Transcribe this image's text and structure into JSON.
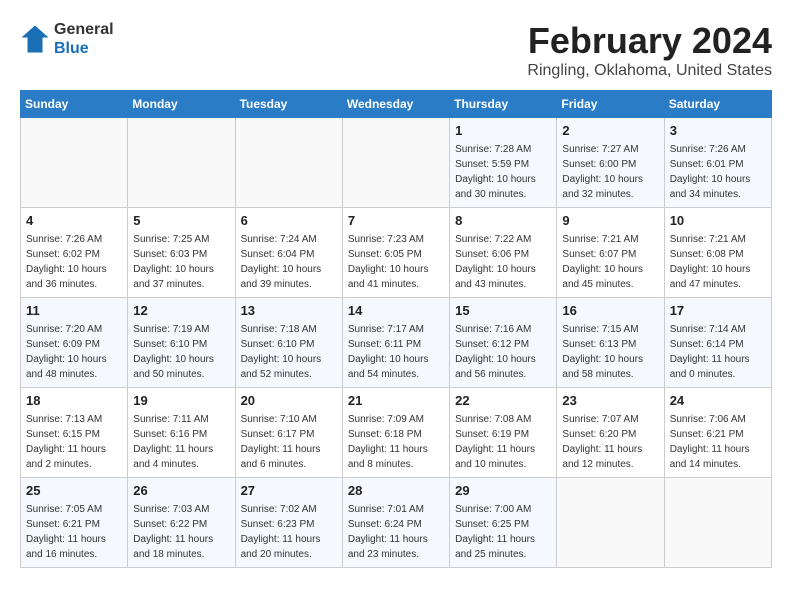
{
  "header": {
    "logo_general": "General",
    "logo_blue": "Blue",
    "month_title": "February 2024",
    "location": "Ringling, Oklahoma, United States"
  },
  "weekdays": [
    "Sunday",
    "Monday",
    "Tuesday",
    "Wednesday",
    "Thursday",
    "Friday",
    "Saturday"
  ],
  "weeks": [
    [
      {
        "day": "",
        "info": ""
      },
      {
        "day": "",
        "info": ""
      },
      {
        "day": "",
        "info": ""
      },
      {
        "day": "",
        "info": ""
      },
      {
        "day": "1",
        "info": "Sunrise: 7:28 AM\nSunset: 5:59 PM\nDaylight: 10 hours\nand 30 minutes."
      },
      {
        "day": "2",
        "info": "Sunrise: 7:27 AM\nSunset: 6:00 PM\nDaylight: 10 hours\nand 32 minutes."
      },
      {
        "day": "3",
        "info": "Sunrise: 7:26 AM\nSunset: 6:01 PM\nDaylight: 10 hours\nand 34 minutes."
      }
    ],
    [
      {
        "day": "4",
        "info": "Sunrise: 7:26 AM\nSunset: 6:02 PM\nDaylight: 10 hours\nand 36 minutes."
      },
      {
        "day": "5",
        "info": "Sunrise: 7:25 AM\nSunset: 6:03 PM\nDaylight: 10 hours\nand 37 minutes."
      },
      {
        "day": "6",
        "info": "Sunrise: 7:24 AM\nSunset: 6:04 PM\nDaylight: 10 hours\nand 39 minutes."
      },
      {
        "day": "7",
        "info": "Sunrise: 7:23 AM\nSunset: 6:05 PM\nDaylight: 10 hours\nand 41 minutes."
      },
      {
        "day": "8",
        "info": "Sunrise: 7:22 AM\nSunset: 6:06 PM\nDaylight: 10 hours\nand 43 minutes."
      },
      {
        "day": "9",
        "info": "Sunrise: 7:21 AM\nSunset: 6:07 PM\nDaylight: 10 hours\nand 45 minutes."
      },
      {
        "day": "10",
        "info": "Sunrise: 7:21 AM\nSunset: 6:08 PM\nDaylight: 10 hours\nand 47 minutes."
      }
    ],
    [
      {
        "day": "11",
        "info": "Sunrise: 7:20 AM\nSunset: 6:09 PM\nDaylight: 10 hours\nand 48 minutes."
      },
      {
        "day": "12",
        "info": "Sunrise: 7:19 AM\nSunset: 6:10 PM\nDaylight: 10 hours\nand 50 minutes."
      },
      {
        "day": "13",
        "info": "Sunrise: 7:18 AM\nSunset: 6:10 PM\nDaylight: 10 hours\nand 52 minutes."
      },
      {
        "day": "14",
        "info": "Sunrise: 7:17 AM\nSunset: 6:11 PM\nDaylight: 10 hours\nand 54 minutes."
      },
      {
        "day": "15",
        "info": "Sunrise: 7:16 AM\nSunset: 6:12 PM\nDaylight: 10 hours\nand 56 minutes."
      },
      {
        "day": "16",
        "info": "Sunrise: 7:15 AM\nSunset: 6:13 PM\nDaylight: 10 hours\nand 58 minutes."
      },
      {
        "day": "17",
        "info": "Sunrise: 7:14 AM\nSunset: 6:14 PM\nDaylight: 11 hours\nand 0 minutes."
      }
    ],
    [
      {
        "day": "18",
        "info": "Sunrise: 7:13 AM\nSunset: 6:15 PM\nDaylight: 11 hours\nand 2 minutes."
      },
      {
        "day": "19",
        "info": "Sunrise: 7:11 AM\nSunset: 6:16 PM\nDaylight: 11 hours\nand 4 minutes."
      },
      {
        "day": "20",
        "info": "Sunrise: 7:10 AM\nSunset: 6:17 PM\nDaylight: 11 hours\nand 6 minutes."
      },
      {
        "day": "21",
        "info": "Sunrise: 7:09 AM\nSunset: 6:18 PM\nDaylight: 11 hours\nand 8 minutes."
      },
      {
        "day": "22",
        "info": "Sunrise: 7:08 AM\nSunset: 6:19 PM\nDaylight: 11 hours\nand 10 minutes."
      },
      {
        "day": "23",
        "info": "Sunrise: 7:07 AM\nSunset: 6:20 PM\nDaylight: 11 hours\nand 12 minutes."
      },
      {
        "day": "24",
        "info": "Sunrise: 7:06 AM\nSunset: 6:21 PM\nDaylight: 11 hours\nand 14 minutes."
      }
    ],
    [
      {
        "day": "25",
        "info": "Sunrise: 7:05 AM\nSunset: 6:21 PM\nDaylight: 11 hours\nand 16 minutes."
      },
      {
        "day": "26",
        "info": "Sunrise: 7:03 AM\nSunset: 6:22 PM\nDaylight: 11 hours\nand 18 minutes."
      },
      {
        "day": "27",
        "info": "Sunrise: 7:02 AM\nSunset: 6:23 PM\nDaylight: 11 hours\nand 20 minutes."
      },
      {
        "day": "28",
        "info": "Sunrise: 7:01 AM\nSunset: 6:24 PM\nDaylight: 11 hours\nand 23 minutes."
      },
      {
        "day": "29",
        "info": "Sunrise: 7:00 AM\nSunset: 6:25 PM\nDaylight: 11 hours\nand 25 minutes."
      },
      {
        "day": "",
        "info": ""
      },
      {
        "day": "",
        "info": ""
      }
    ]
  ]
}
